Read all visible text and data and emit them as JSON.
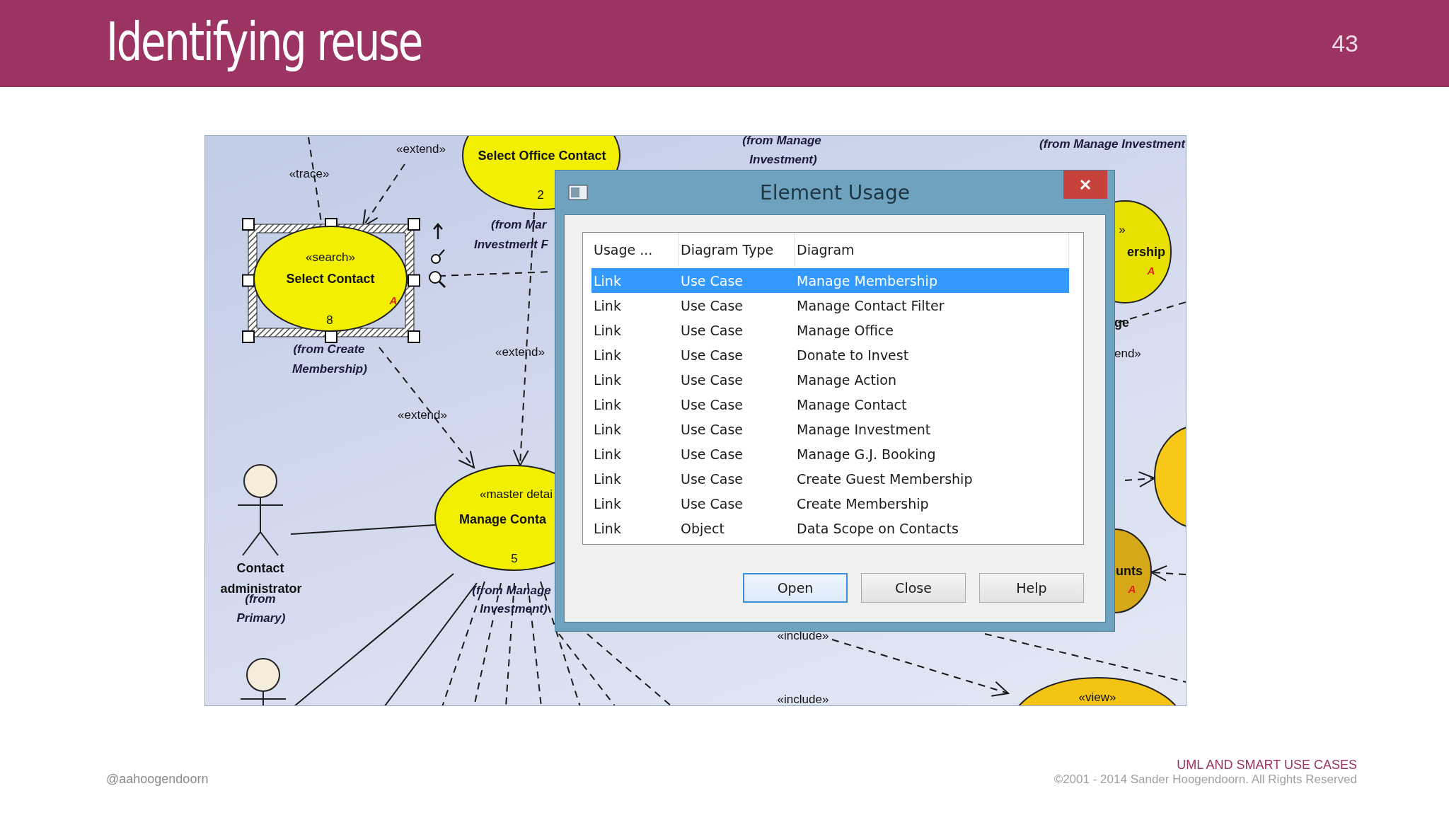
{
  "slide": {
    "title": "Identifying reuse",
    "page_number": "43"
  },
  "diagram": {
    "use_cases": [
      {
        "stereotype": "«search»",
        "name": "Select Contact",
        "number": "8",
        "flag": "A",
        "origin": [
          "(from Create",
          "Membership)"
        ],
        "color": "#f2f000",
        "selected": true
      },
      {
        "name": "Select Office Contact",
        "number": "2",
        "origin": [
          "(from Mar",
          "Investment F"
        ],
        "color": "#f2f000",
        "selected": false
      },
      {
        "stereotype": "«master detai",
        "name": "Manage Conta",
        "number": "5",
        "origin": [
          "(from Manage",
          "Investment)"
        ],
        "color": "#f2f000",
        "selected": false
      },
      {
        "stereotype": "»",
        "name": "ership",
        "flag": "A",
        "color": "#e8e000",
        "selected": false
      },
      {
        "name": "unts",
        "flag": "A",
        "color": "#d4a818",
        "selected": false
      },
      {
        "stereotype": "«view»",
        "color": "#f3c414",
        "selected": false
      },
      {
        "color": "#f8c818",
        "selected": false
      }
    ],
    "actors": [
      {
        "kind": "actor",
        "name": [
          "Contact",
          "administrator"
        ],
        "origin": [
          "(from",
          "Primary)"
        ]
      },
      {
        "kind": "actor"
      }
    ],
    "labels": [
      {
        "kind": "stereotype",
        "text": "«extend»"
      },
      {
        "kind": "origin",
        "text": "(from Manage"
      },
      {
        "kind": "origin",
        "text": "(from Manage Investment"
      },
      {
        "kind": "origin",
        "text": "Investment)"
      },
      {
        "kind": "stereotype",
        "text": "«trace»"
      },
      {
        "kind": "name",
        "text": "ge"
      },
      {
        "kind": "stereotype",
        "text": "«extend»"
      },
      {
        "kind": "stereotype",
        "text": "end»"
      },
      {
        "kind": "stereotype",
        "text": "«extend»"
      },
      {
        "kind": "stereotype",
        "text": "«include»"
      },
      {
        "kind": "stereotype",
        "text": "«include»"
      }
    ]
  },
  "dialog": {
    "title": "Element Usage",
    "columns": [
      "Usage ...",
      "Diagram Type",
      "Diagram"
    ],
    "rows": [
      {
        "cells": [
          "Link",
          "Use Case",
          "Manage Membership"
        ],
        "selected": true
      },
      {
        "cells": [
          "Link",
          "Use Case",
          "Manage Contact Filter"
        ],
        "selected": false
      },
      {
        "cells": [
          "Link",
          "Use Case",
          "Manage Office"
        ],
        "selected": false
      },
      {
        "cells": [
          "Link",
          "Use Case",
          "Donate to Invest"
        ],
        "selected": false
      },
      {
        "cells": [
          "Link",
          "Use Case",
          "Manage Action"
        ],
        "selected": false
      },
      {
        "cells": [
          "Link",
          "Use Case",
          "Manage Contact"
        ],
        "selected": false
      },
      {
        "cells": [
          "Link",
          "Use Case",
          "Manage Investment"
        ],
        "selected": false
      },
      {
        "cells": [
          "Link",
          "Use Case",
          "Manage G.J. Booking"
        ],
        "selected": false
      },
      {
        "cells": [
          "Link",
          "Use Case",
          "Create Guest Membership"
        ],
        "selected": false
      },
      {
        "cells": [
          "Link",
          "Use Case",
          "Create Membership"
        ],
        "selected": false
      },
      {
        "cells": [
          "Link",
          "Object",
          "Data Scope on Contacts"
        ],
        "selected": false
      }
    ],
    "buttons": [
      {
        "label": "Open",
        "default": true
      },
      {
        "label": "Close",
        "default": false
      },
      {
        "label": "Help",
        "default": false
      }
    ]
  },
  "footer": {
    "handle": "@aahoogendoorn",
    "course": "UML AND SMART USE CASES",
    "copyright": "©2001 - 2014 Sander Hoogendoorn. All Rights Reserved"
  }
}
